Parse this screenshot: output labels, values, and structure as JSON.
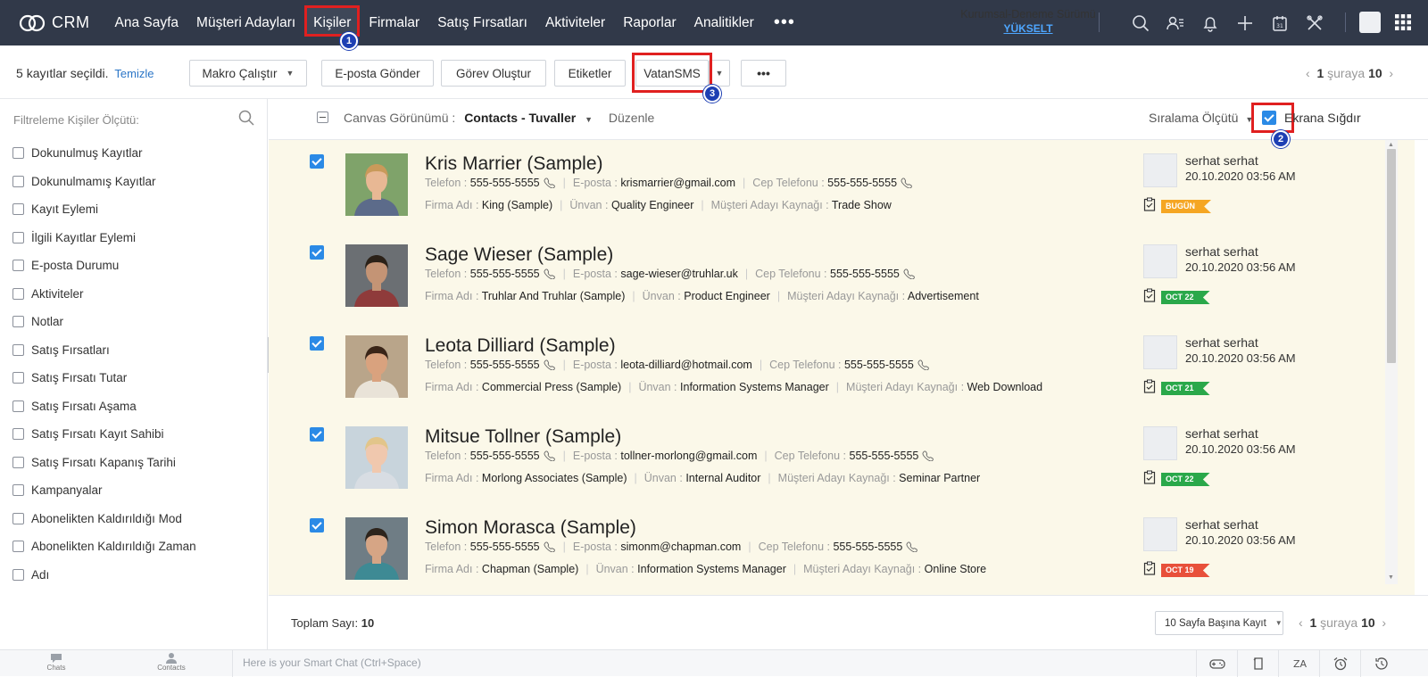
{
  "app": {
    "logo_text": "CRM"
  },
  "nav": {
    "items": [
      "Ana Sayfa",
      "Müşteri Adayları",
      "Kişiler",
      "Firmalar",
      "Satış Fırsatları",
      "Aktiviteler",
      "Raporlar",
      "Analitikler"
    ],
    "active": "Kişiler",
    "more": "•••"
  },
  "trial": {
    "label": "Kurumsal-Deneme Sürümü",
    "upgrade": "YÜKSELT"
  },
  "topbar_icons": [
    "search-icon",
    "contacts-icon",
    "bell-icon",
    "plus-icon",
    "calendar-icon",
    "tools-icon",
    "avatar",
    "apps-grid-icon"
  ],
  "badges": {
    "one": "1",
    "two": "2",
    "three": "3"
  },
  "actionbar": {
    "selected_count": "5",
    "selected_text": "kayıtlar seçildi.",
    "clear": "Temizle",
    "macro": "Makro Çalıştır",
    "email": "E-posta Gönder",
    "task": "Görev Oluştur",
    "tags": "Etiketler",
    "sms": "VatanSMS",
    "more": "•••"
  },
  "pager": {
    "current": "1",
    "word": "şuraya",
    "total": "10"
  },
  "sidebar": {
    "title": "Filtreleme Kişiler Ölçütü:",
    "filters": [
      "Dokunulmuş Kayıtlar",
      "Dokunulmamış Kayıtlar",
      "Kayıt Eylemi",
      "İlgili Kayıtlar Eylemi",
      "E-posta Durumu",
      "Aktiviteler",
      "Notlar",
      "Satış Fırsatları",
      "Satış Fırsatı Tutar",
      "Satış Fırsatı Aşama",
      "Satış Fırsatı Kayıt Sahibi",
      "Satış Fırsatı Kapanış Tarihi",
      "Kampanyalar",
      "Abonelikten Kaldırıldığı Mod",
      "Abonelikten Kaldırıldığı Zaman",
      "Adı"
    ]
  },
  "listhead": {
    "canvas_label": "Canvas Görünümü :",
    "canvas_value": "Contacts - Tuvaller",
    "edit": "Düzenle",
    "sort": "Sıralama Ölçütü",
    "fit": "Ekrana Sığdır",
    "fit_checked": true
  },
  "labels": {
    "phone": "Telefon :",
    "email": "E-posta :",
    "mobile": "Cep Telefonu :",
    "company": "Firma Adı :",
    "title": "Ünvan :",
    "source": "Müşteri Adayı Kaynağı :"
  },
  "records": [
    {
      "name": "Kris Marrier (Sample)",
      "phone": "555-555-5555",
      "email": "krismarrier@gmail.com",
      "mobile": "555-555-5555",
      "company": "King (Sample)",
      "title": "Quality Engineer",
      "source": "Trade Show",
      "owner": "serhat serhat",
      "date": "20.10.2020 03:56 AM",
      "tag": "BUGÜN",
      "tag_color": "#f5a623",
      "checked": true
    },
    {
      "name": "Sage Wieser (Sample)",
      "phone": "555-555-5555",
      "email": "sage-wieser@truhlar.uk",
      "mobile": "555-555-5555",
      "company": "Truhlar And Truhlar (Sample)",
      "title": "Product Engineer",
      "source": "Advertisement",
      "owner": "serhat serhat",
      "date": "20.10.2020 03:56 AM",
      "tag": "OCT 22",
      "tag_color": "#2aa84a",
      "checked": true
    },
    {
      "name": "Leota Dilliard (Sample)",
      "phone": "555-555-5555",
      "email": "leota-dilliard@hotmail.com",
      "mobile": "555-555-5555",
      "company": "Commercial Press (Sample)",
      "title": "Information Systems Manager",
      "source": "Web Download",
      "owner": "serhat serhat",
      "date": "20.10.2020 03:56 AM",
      "tag": "OCT 21",
      "tag_color": "#2aa84a",
      "checked": true
    },
    {
      "name": "Mitsue Tollner (Sample)",
      "phone": "555-555-5555",
      "email": "tollner-morlong@gmail.com",
      "mobile": "555-555-5555",
      "company": "Morlong Associates (Sample)",
      "title": "Internal Auditor",
      "source": "Seminar Partner",
      "owner": "serhat serhat",
      "date": "20.10.2020 03:56 AM",
      "tag": "OCT 22",
      "tag_color": "#2aa84a",
      "checked": true
    },
    {
      "name": "Simon Morasca (Sample)",
      "phone": "555-555-5555",
      "email": "simonm@chapman.com",
      "mobile": "555-555-5555",
      "company": "Chapman (Sample)",
      "title": "Information Systems Manager",
      "source": "Online Store",
      "owner": "serhat serhat",
      "date": "20.10.2020 03:56 AM",
      "tag": "OCT 19",
      "tag_color": "#e8503a",
      "checked": true
    }
  ],
  "footer": {
    "total_label": "Toplam Sayı:",
    "total_value": "10",
    "per_page": "10 Sayfa Başına Kayıt"
  },
  "bottombar": {
    "chats": "Chats",
    "contacts": "Contacts",
    "smartchat_placeholder": "Here is your Smart Chat (Ctrl+Space)",
    "icons": [
      "gamepad-icon",
      "notes-icon",
      "translate-icon",
      "alarm-icon",
      "history-icon"
    ]
  }
}
